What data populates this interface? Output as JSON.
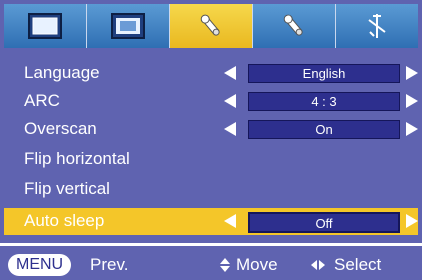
{
  "tabs": [
    {
      "icon": "picture-icon",
      "active": false
    },
    {
      "icon": "screen-icon",
      "active": false
    },
    {
      "icon": "option1-tool-icon",
      "active": true
    },
    {
      "icon": "option2-tool-icon",
      "active": false
    },
    {
      "icon": "network-icon",
      "active": false
    }
  ],
  "menu": [
    {
      "label": "Language",
      "value": "English",
      "selected": false
    },
    {
      "label": "ARC",
      "value": "4 : 3",
      "selected": false
    },
    {
      "label": "Overscan",
      "value": "On",
      "selected": false
    },
    {
      "label": "Flip horizontal",
      "value": null,
      "selected": false
    },
    {
      "label": "Flip vertical",
      "value": null,
      "selected": false
    },
    {
      "label": "Auto sleep",
      "value": "Off",
      "selected": true
    }
  ],
  "footer": {
    "menu_key": "MENU",
    "prev_label": "Prev.",
    "move_label": "Move",
    "select_label": "Select"
  },
  "colors": {
    "background": "#5f63b0",
    "tab_active": "#f4c629",
    "value_box": "#2d2f8e",
    "selected_row": "#f4c629"
  }
}
